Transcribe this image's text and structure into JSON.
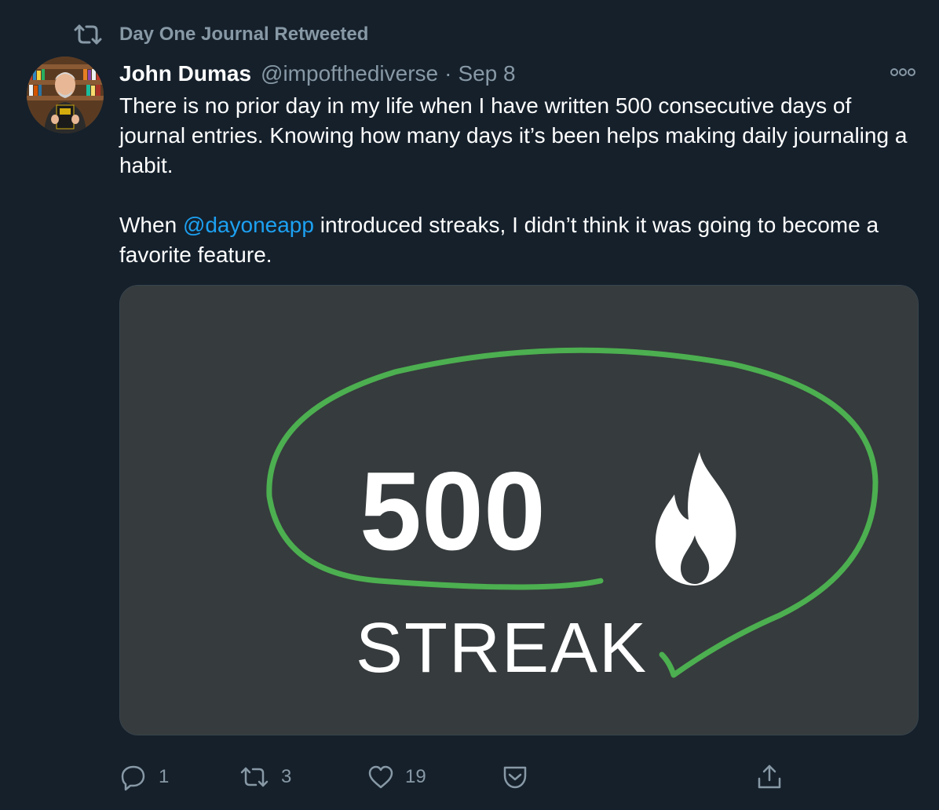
{
  "retweet_banner": {
    "icon": "retweet-icon",
    "label": "Day One Journal Retweeted"
  },
  "author": {
    "name": "John Dumas",
    "handle": "@impofthediverse",
    "separator": "·",
    "date": "Sep 8",
    "avatar": "avatar-photo"
  },
  "tweet": {
    "paragraph_1": "There is no prior day in my life when I have written 500 consecutive days of journal entries. Knowing how many days it’s been helps making daily journaling a habit.",
    "paragraph_2_before": "When ",
    "paragraph_2_mention": "@dayoneapp",
    "paragraph_2_after": " introduced streaks, I didn’t think it was going to become a favorite feature."
  },
  "media": {
    "streak_number": "500",
    "streak_label": "STREAK",
    "flame_icon": "flame-icon",
    "circle_color": "#4caf50",
    "background_color": "#363b3d"
  },
  "actions": {
    "reply": {
      "icon": "reply-icon",
      "count": "1"
    },
    "retweet": {
      "icon": "retweet-icon",
      "count": "3"
    },
    "like": {
      "icon": "heart-icon",
      "count": "19"
    },
    "save": {
      "icon": "pocket-icon"
    },
    "share": {
      "icon": "share-icon"
    }
  },
  "colors": {
    "background": "#15202b",
    "muted": "#8899a6",
    "link": "#1da1f2"
  }
}
